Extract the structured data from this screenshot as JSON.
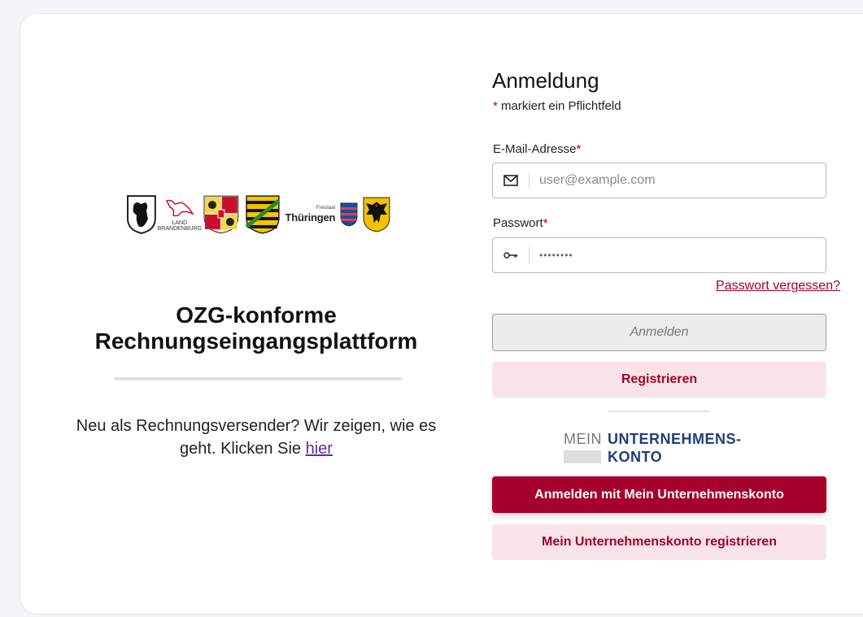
{
  "logos": {
    "brandenburg_line1": "LAND",
    "brandenburg_line2": "BRANDENBURG",
    "thueringen_small": "Freistaat",
    "thueringen_big": "Thüringen"
  },
  "left": {
    "title_line1": "OZG-konforme",
    "title_line2": "Rechnungseingangsplattform",
    "intro_text": "Neu als Rechnungsversender? Wir zeigen, wie es geht. Klicken Sie ",
    "intro_link": "hier"
  },
  "login": {
    "title": "Anmeldung",
    "required_star": "*",
    "required_note": " markiert ein Pflichtfeld",
    "email_label": "E-Mail-Adresse",
    "email_placeholder": "user@example.com",
    "password_label": "Passwort",
    "password_value": "••••••••",
    "forgot": "Passwort vergessen?",
    "submit": "Anmelden",
    "register": "Registrieren"
  },
  "muk": {
    "logo_mein": "MEIN",
    "logo_unternehmens": "UNTERNEHMENS-",
    "logo_konto": "KONTO",
    "login_button": "Anmelden mit Mein Unternehmenskonto",
    "register_button": "Mein Unternehmenskonto registrieren"
  },
  "colors": {
    "primary": "#a6002c",
    "primary_light": "#f8e4e8",
    "muk_blue": "#1f3f7a"
  },
  "icons": [
    "berlin-bear-icon",
    "brandenburg-eagle-icon",
    "mecklenburg-crest-icon",
    "saxony-crest-icon",
    "thueringen-lion-icon",
    "federal-eagle-icon",
    "envelope-icon",
    "key-icon"
  ]
}
